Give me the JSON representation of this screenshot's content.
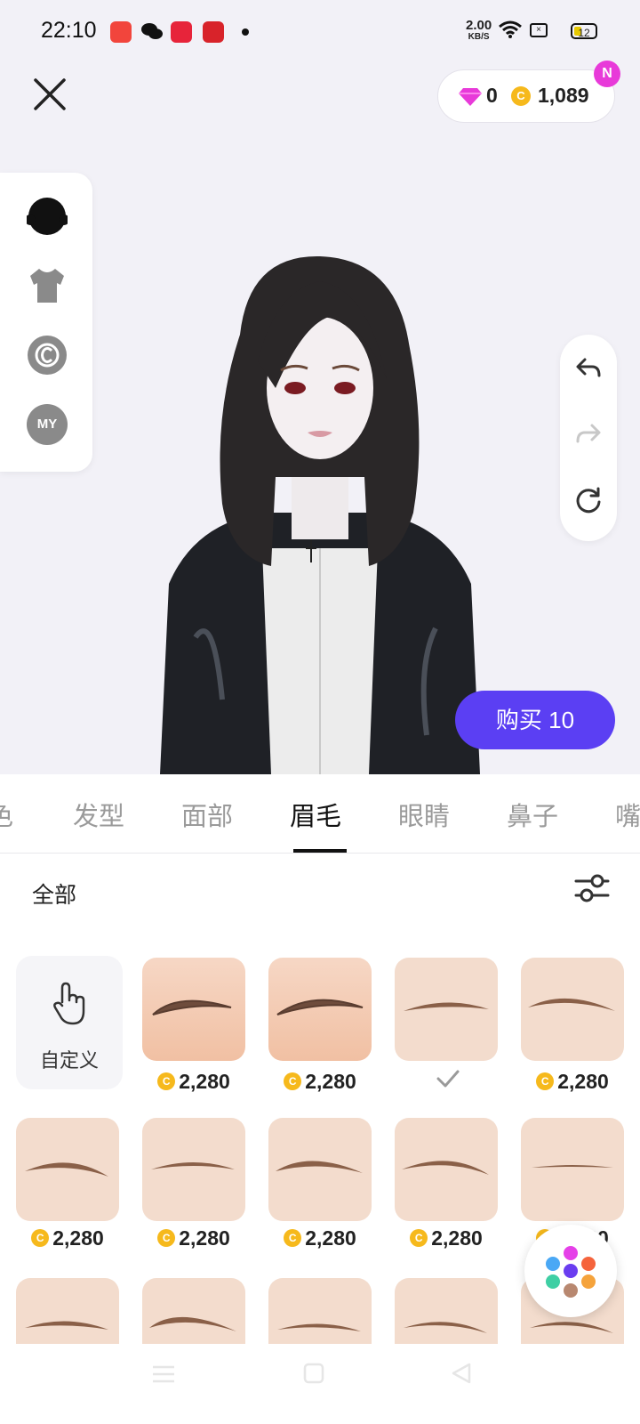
{
  "status_bar": {
    "time": "22:10",
    "net_speed_value": "2.00",
    "net_speed_unit": "KB/S",
    "battery": "12"
  },
  "header": {
    "close_icon": "close-icon",
    "diamonds": "0",
    "coins": "1,089",
    "new_badge": "N"
  },
  "left_panel": {
    "items": [
      "hair-icon",
      "shirt-icon",
      "copyright-icon",
      "my-icon"
    ],
    "my_label": "MY"
  },
  "right_panel": {
    "items": [
      "undo-icon",
      "redo-icon",
      "reset-icon"
    ]
  },
  "buy_button": "购买 10",
  "tabs": [
    "色",
    "发型",
    "面部",
    "眉毛",
    "眼睛",
    "鼻子",
    "嘴"
  ],
  "active_tab": "眉毛",
  "filter": {
    "label": "全部",
    "icon": "sliders-icon"
  },
  "custom_tile": {
    "label": "自定义",
    "icon": "hand-pointer-icon"
  },
  "coin_symbol": "C",
  "eyebrows": {
    "row1": [
      "2,280",
      "2,280",
      "",
      "2,280"
    ],
    "row2": [
      "2,280",
      "2,280",
      "2,280",
      "2,280",
      "2,280"
    ]
  },
  "colors": {
    "accent": "#5b3ff3",
    "coin": "#f6b91c",
    "diamond": "#e83ad9",
    "skin": "#f3d5c2",
    "brow": "#8a6048"
  }
}
